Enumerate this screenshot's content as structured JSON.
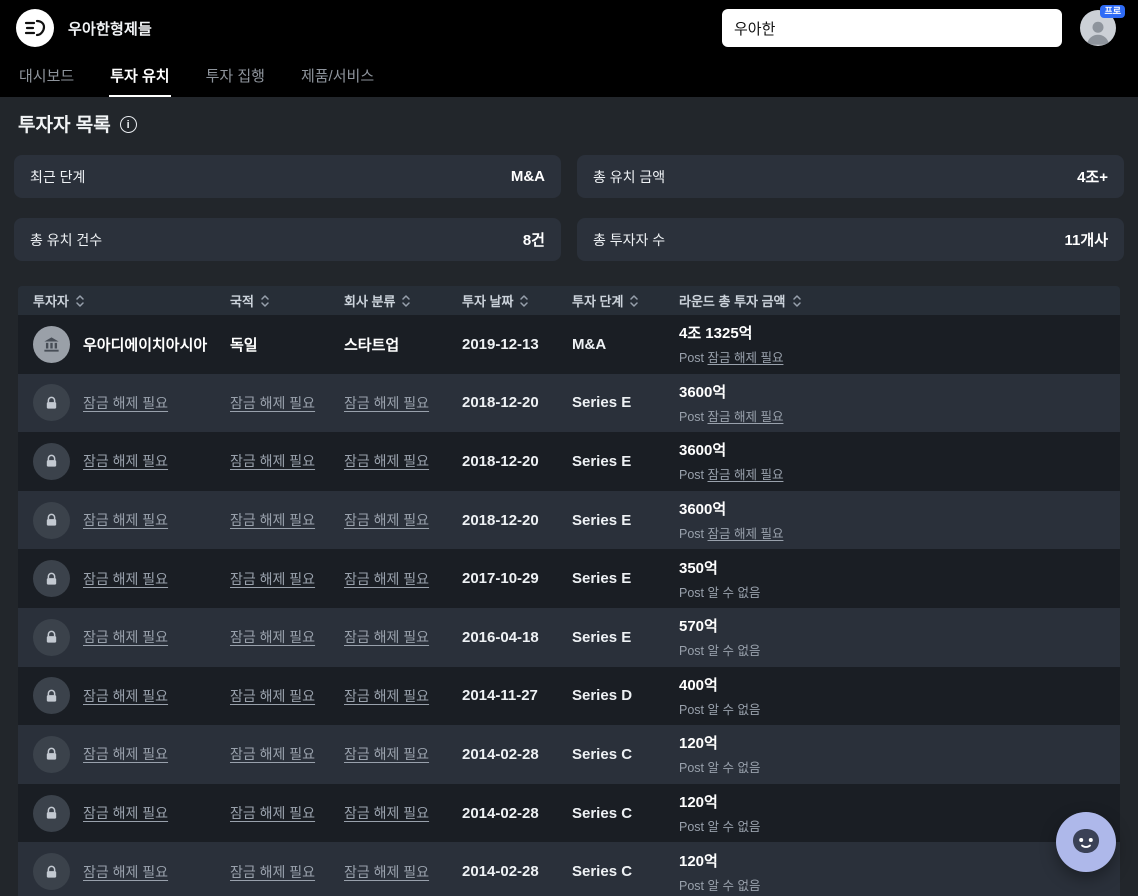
{
  "app": {
    "title": "우아한형제들",
    "search_value": "우아한",
    "profile_badge": "프로"
  },
  "nav": {
    "tabs": [
      {
        "label": "대시보드",
        "active": false
      },
      {
        "label": "투자 유치",
        "active": true
      },
      {
        "label": "투자 집행",
        "active": false
      },
      {
        "label": "제품/서비스",
        "active": false
      }
    ]
  },
  "page": {
    "title": "투자자 목록"
  },
  "stats": [
    {
      "label": "최근 단계",
      "value": "M&A"
    },
    {
      "label": "총 유치 금액",
      "value": "4조+"
    },
    {
      "label": "총 유치 건수",
      "value": "8건"
    },
    {
      "label": "총 투자자 수",
      "value": "11개사"
    }
  ],
  "table": {
    "columns": [
      "투자자",
      "국적",
      "회사 분류",
      "투자 날짜",
      "투자 단계",
      "라운드 총 투자 금액"
    ],
    "locked_label": "잠금 해제 필요",
    "post_prefix": "Post",
    "rows": [
      {
        "locked": false,
        "investor": "우아디에이치아시아",
        "nationality": "독일",
        "category": "스타트업",
        "date": "2019-12-13",
        "stage": "M&A",
        "amount": "4조 1325억",
        "post": "잠금 해제 필요",
        "post_locked": true
      },
      {
        "locked": true,
        "date": "2018-12-20",
        "stage": "Series E",
        "amount": "3600억",
        "post": "잠금 해제 필요",
        "post_locked": true
      },
      {
        "locked": true,
        "date": "2018-12-20",
        "stage": "Series E",
        "amount": "3600억",
        "post": "잠금 해제 필요",
        "post_locked": true
      },
      {
        "locked": true,
        "date": "2018-12-20",
        "stage": "Series E",
        "amount": "3600억",
        "post": "잠금 해제 필요",
        "post_locked": true
      },
      {
        "locked": true,
        "date": "2017-10-29",
        "stage": "Series E",
        "amount": "350억",
        "post": "알 수 없음",
        "post_locked": false
      },
      {
        "locked": true,
        "date": "2016-04-18",
        "stage": "Series E",
        "amount": "570억",
        "post": "알 수 없음",
        "post_locked": false
      },
      {
        "locked": true,
        "date": "2014-11-27",
        "stage": "Series D",
        "amount": "400억",
        "post": "알 수 없음",
        "post_locked": false
      },
      {
        "locked": true,
        "date": "2014-02-28",
        "stage": "Series C",
        "amount": "120억",
        "post": "알 수 없음",
        "post_locked": false
      },
      {
        "locked": true,
        "date": "2014-02-28",
        "stage": "Series C",
        "amount": "120억",
        "post": "알 수 없음",
        "post_locked": false
      },
      {
        "locked": true,
        "date": "2014-02-28",
        "stage": "Series C",
        "amount": "120억",
        "post": "알 수 없음",
        "post_locked": false
      }
    ]
  }
}
